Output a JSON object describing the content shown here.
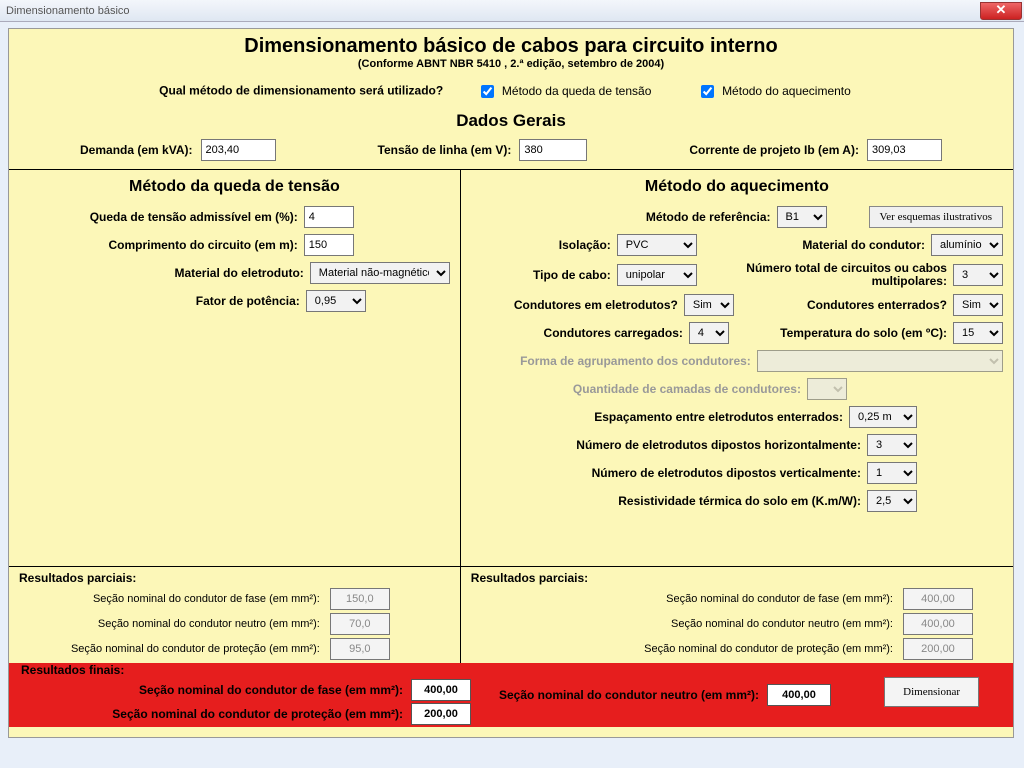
{
  "window_title": "Dimensionamento básico",
  "header": {
    "title": "Dimensionamento básico de cabos para circuito interno",
    "subtitle": "(Conforme ABNT NBR 5410 , 2.ª edição, setembro de 2004)"
  },
  "method_question": "Qual método de dimensionamento será utilizado?",
  "methods": {
    "voltage_drop_label": "Método da queda de tensão",
    "voltage_drop_checked": true,
    "heating_label": "Método do aquecimento",
    "heating_checked": true
  },
  "general": {
    "heading": "Dados Gerais",
    "demand_label": "Demanda (em kVA):",
    "demand_value": "203,40",
    "line_voltage_label": "Tensão de linha (em V):",
    "line_voltage_value": "380",
    "project_current_label": "Corrente de projeto Ib (em A):",
    "project_current_value": "309,03"
  },
  "voltage_drop": {
    "heading": "Método da queda de tensão",
    "admissible_label": "Queda de tensão admissível em (%):",
    "admissible_value": "4",
    "circuit_length_label": "Comprimento do circuito (em m):",
    "circuit_length_value": "150",
    "conduit_material_label": "Material do eletroduto:",
    "conduit_material_value": "Material não-magnético",
    "power_factor_label": "Fator de potência:",
    "power_factor_value": "0,95"
  },
  "heating": {
    "heading": "Método do aquecimento",
    "ref_method_label": "Método de referência:",
    "ref_method_value": "B1",
    "schemes_button": "Ver esquemas ilustrativos",
    "insulation_label": "Isolação:",
    "insulation_value": "PVC",
    "conductor_material_label": "Material do condutor:",
    "conductor_material_value": "alumínio",
    "cable_type_label": "Tipo de cabo:",
    "cable_type_value": "unipolar",
    "total_circuits_label": "Número total de circuitos ou cabos multipolares:",
    "total_circuits_value": "3",
    "in_conduits_label": "Condutores em eletrodutos?",
    "in_conduits_value": "Sim",
    "buried_label": "Condutores enterrados?",
    "buried_value": "Sim",
    "loaded_conductors_label": "Condutores carregados:",
    "loaded_conductors_value": "4",
    "soil_temp_label": "Temperatura do solo (em ºC):",
    "soil_temp_value": "15",
    "grouping_label": "Forma de agrupamento dos condutores:",
    "layers_label": "Quantidade de camadas de condutores:",
    "buried_spacing_label": "Espaçamento entre eletrodutos enterrados:",
    "buried_spacing_value": "0,25 m",
    "horiz_conduits_label": "Número de eletrodutos dipostos horizontalmente:",
    "horiz_conduits_value": "3",
    "vert_conduits_label": "Número de eletrodutos dipostos verticalmente:",
    "vert_conduits_value": "1",
    "soil_resistivity_label": "Resistividade térmica do solo em (K.m/W):",
    "soil_resistivity_value": "2,5"
  },
  "partial": {
    "title": "Resultados parciais:",
    "phase_label": "Seção nominal do condutor de fase (em mm²):",
    "neutral_label": "Seção nominal do condutor neutro (em mm²):",
    "protection_label": "Seção nominal do condutor de proteção (em mm²):",
    "left": {
      "phase": "150,0",
      "neutral": "70,0",
      "protection": "95,0"
    },
    "right": {
      "phase": "400,00",
      "neutral": "400,00",
      "protection": "200,00"
    }
  },
  "final": {
    "title": "Resultados finais:",
    "phase_label": "Seção nominal do condutor de fase (em mm²):",
    "phase_value": "400,00",
    "protection_label": "Seção nominal do condutor de proteção (em mm²):",
    "protection_value": "200,00",
    "neutral_label": "Seção nominal do condutor neutro (em mm²):",
    "neutral_value": "400,00",
    "button": "Dimensionar"
  }
}
